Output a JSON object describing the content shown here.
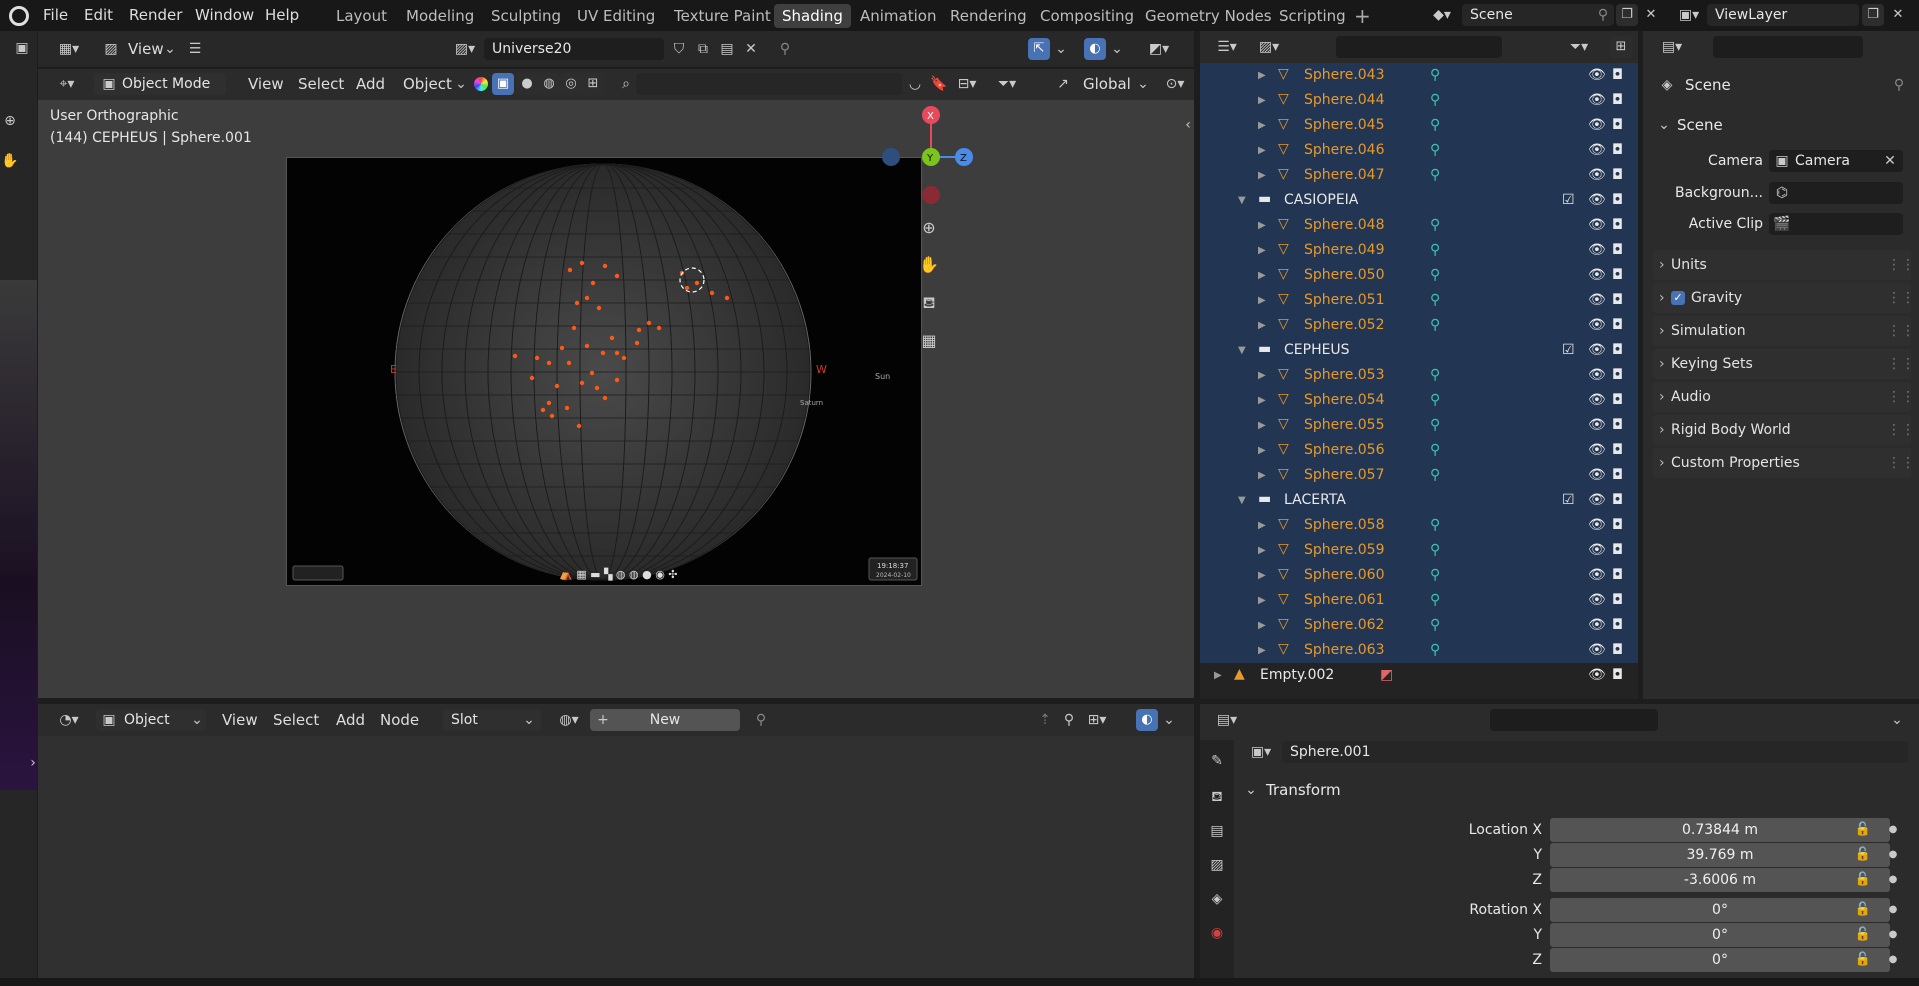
{
  "menu": [
    "File",
    "Edit",
    "Render",
    "Window",
    "Help"
  ],
  "workspaces": [
    "Layout",
    "Modeling",
    "Sculpting",
    "UV Editing",
    "Texture Paint",
    "Shading",
    "Animation",
    "Rendering",
    "Compositing",
    "Geometry Nodes",
    "Scripting"
  ],
  "active_workspace": "Shading",
  "scene_name": "Scene",
  "view_layer": "ViewLayer",
  "image_editor": {
    "view_label": "View",
    "image_name": "Universe20"
  },
  "viewport": {
    "mode": "Object Mode",
    "menus": [
      "View",
      "Select",
      "Add",
      "Object"
    ],
    "transform": "Global",
    "view_name": "User Orthographic",
    "context": "(144) CEPHEUS | Sphere.001",
    "gizmo": {
      "x": "X",
      "y": "Y",
      "z": "Z"
    },
    "image_labels": {
      "sun": "Sun",
      "saturn": "Saturn",
      "east": "E",
      "west": "W",
      "time": "19:18:37",
      "date": "2024-02-10"
    }
  },
  "outliner": {
    "rows": [
      {
        "type": "obj",
        "label": "Sphere.043"
      },
      {
        "type": "obj",
        "label": "Sphere.044"
      },
      {
        "type": "obj",
        "label": "Sphere.045"
      },
      {
        "type": "obj",
        "label": "Sphere.046"
      },
      {
        "type": "obj",
        "label": "Sphere.047"
      },
      {
        "type": "coll",
        "label": "CASIOPEIA"
      },
      {
        "type": "obj",
        "label": "Sphere.048"
      },
      {
        "type": "obj",
        "label": "Sphere.049"
      },
      {
        "type": "obj",
        "label": "Sphere.050"
      },
      {
        "type": "obj",
        "label": "Sphere.051"
      },
      {
        "type": "obj",
        "label": "Sphere.052"
      },
      {
        "type": "coll",
        "label": "CEPHEUS"
      },
      {
        "type": "obj",
        "label": "Sphere.053"
      },
      {
        "type": "obj",
        "label": "Sphere.054"
      },
      {
        "type": "obj",
        "label": "Sphere.055"
      },
      {
        "type": "obj",
        "label": "Sphere.056"
      },
      {
        "type": "obj",
        "label": "Sphere.057"
      },
      {
        "type": "coll",
        "label": "LACERTA"
      },
      {
        "type": "obj",
        "label": "Sphere.058"
      },
      {
        "type": "obj",
        "label": "Sphere.059"
      },
      {
        "type": "obj",
        "label": "Sphere.060"
      },
      {
        "type": "obj",
        "label": "Sphere.061"
      },
      {
        "type": "obj",
        "label": "Sphere.062"
      },
      {
        "type": "obj",
        "label": "Sphere.063"
      },
      {
        "type": "empty",
        "label": "Empty.002"
      }
    ]
  },
  "scene_props": {
    "title": "Scene",
    "section": "Scene",
    "camera_label": "Camera",
    "camera_value": "Camera",
    "background_label": "Backgroun...",
    "clip_label": "Active Clip",
    "panels": [
      "Units",
      "Gravity",
      "Simulation",
      "Keying Sets",
      "Audio",
      "Rigid Body World",
      "Custom Properties"
    ]
  },
  "shader": {
    "type": "Object",
    "menus": [
      "View",
      "Select",
      "Add",
      "Node"
    ],
    "slot": "Slot",
    "new_label": "New"
  },
  "object_props": {
    "object_name": "Sphere.001",
    "panel": "Transform",
    "location": {
      "label": "Location X",
      "x": "0.73844 m",
      "y": "39.769 m",
      "z": "-3.6006 m"
    },
    "rotation": {
      "label": "Rotation X",
      "x": "0°",
      "y": "0°",
      "z": "0°"
    },
    "axis_y": "Y",
    "axis_z": "Z"
  },
  "colors": {
    "selected_row": "#223553",
    "object_orange": "#e69a2a",
    "accent_blue": "#4772b3"
  }
}
